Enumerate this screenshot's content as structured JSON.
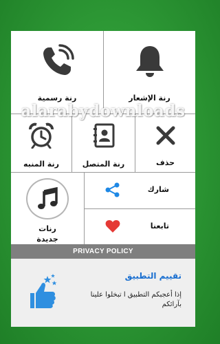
{
  "grid": {
    "official_ringtone": "رنة رسمية",
    "notification_ringtone": "رنة الإشعار",
    "alarm_ringtone": "رنة المنبه",
    "contact_ringtone": "رنة المتصل",
    "delete": "حذف",
    "new_ringtones": "رنات\nجديدة",
    "share": "شارك",
    "follow_us": "تابعنا"
  },
  "watermark": "alarabydownloads",
  "privacy_policy": "PRIVACY POLICY",
  "rate": {
    "title": "تقييم التطبيق",
    "description": "إذا أعجبكم التطبيق ا تبخلوا علينا بآرائكم"
  },
  "colors": {
    "background": "#2e9a36",
    "icon_dark": "#3a3a3a",
    "share_blue": "#1e88e5",
    "heart_red": "#e53935",
    "rate_blue": "#1a6fd0",
    "policy_bar": "#7f7f7f"
  }
}
